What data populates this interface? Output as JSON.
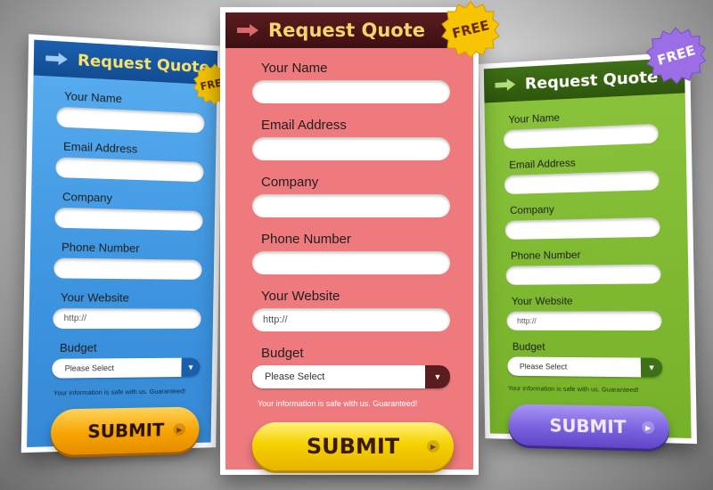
{
  "colors": {
    "blue_card": "#3d95e0",
    "pink_card": "#ee7a7e",
    "green_card": "#7ab42c",
    "yellow_title": "#f5d46a",
    "badge_yellow": "#f6c400",
    "badge_purple": "#9b6ee6"
  },
  "cards": {
    "blue": {
      "title": "Request Quote",
      "badge": "FREE",
      "labels": {
        "name": "Your Name",
        "email": "Email Address",
        "company": "Company",
        "phone": "Phone Number",
        "website": "Your Website",
        "budget": "Budget"
      },
      "website_placeholder": "http://",
      "budget_value": "Please Select",
      "note": "Your information is safe with us. Guaranteed!",
      "submit": "SUBMIT"
    },
    "pink": {
      "title": "Request Quote",
      "badge": "FREE",
      "labels": {
        "name": "Your Name",
        "email": "Email Address",
        "company": "Company",
        "phone": "Phone Number",
        "website": "Your Website",
        "budget": "Budget"
      },
      "website_placeholder": "http://",
      "budget_value": "Please Select",
      "note": "Your information is safe with us. Guaranteed!",
      "submit": "SUBMIT"
    },
    "green": {
      "title": "Request Quote",
      "badge": "FREE",
      "labels": {
        "name": "Your Name",
        "email": "Email Address",
        "company": "Company",
        "phone": "Phone Number",
        "website": "Your Website",
        "budget": "Budget"
      },
      "website_placeholder": "http://",
      "budget_value": "Please Select",
      "note": "Your information is safe with us. Guaranteed!",
      "submit": "SUBMIT"
    }
  },
  "icons": {
    "header_arrow": "arrow-right-icon",
    "select_caret": "caret-down-icon",
    "submit_go": "arrow-circle-icon",
    "badge": "starburst-badge-icon"
  }
}
